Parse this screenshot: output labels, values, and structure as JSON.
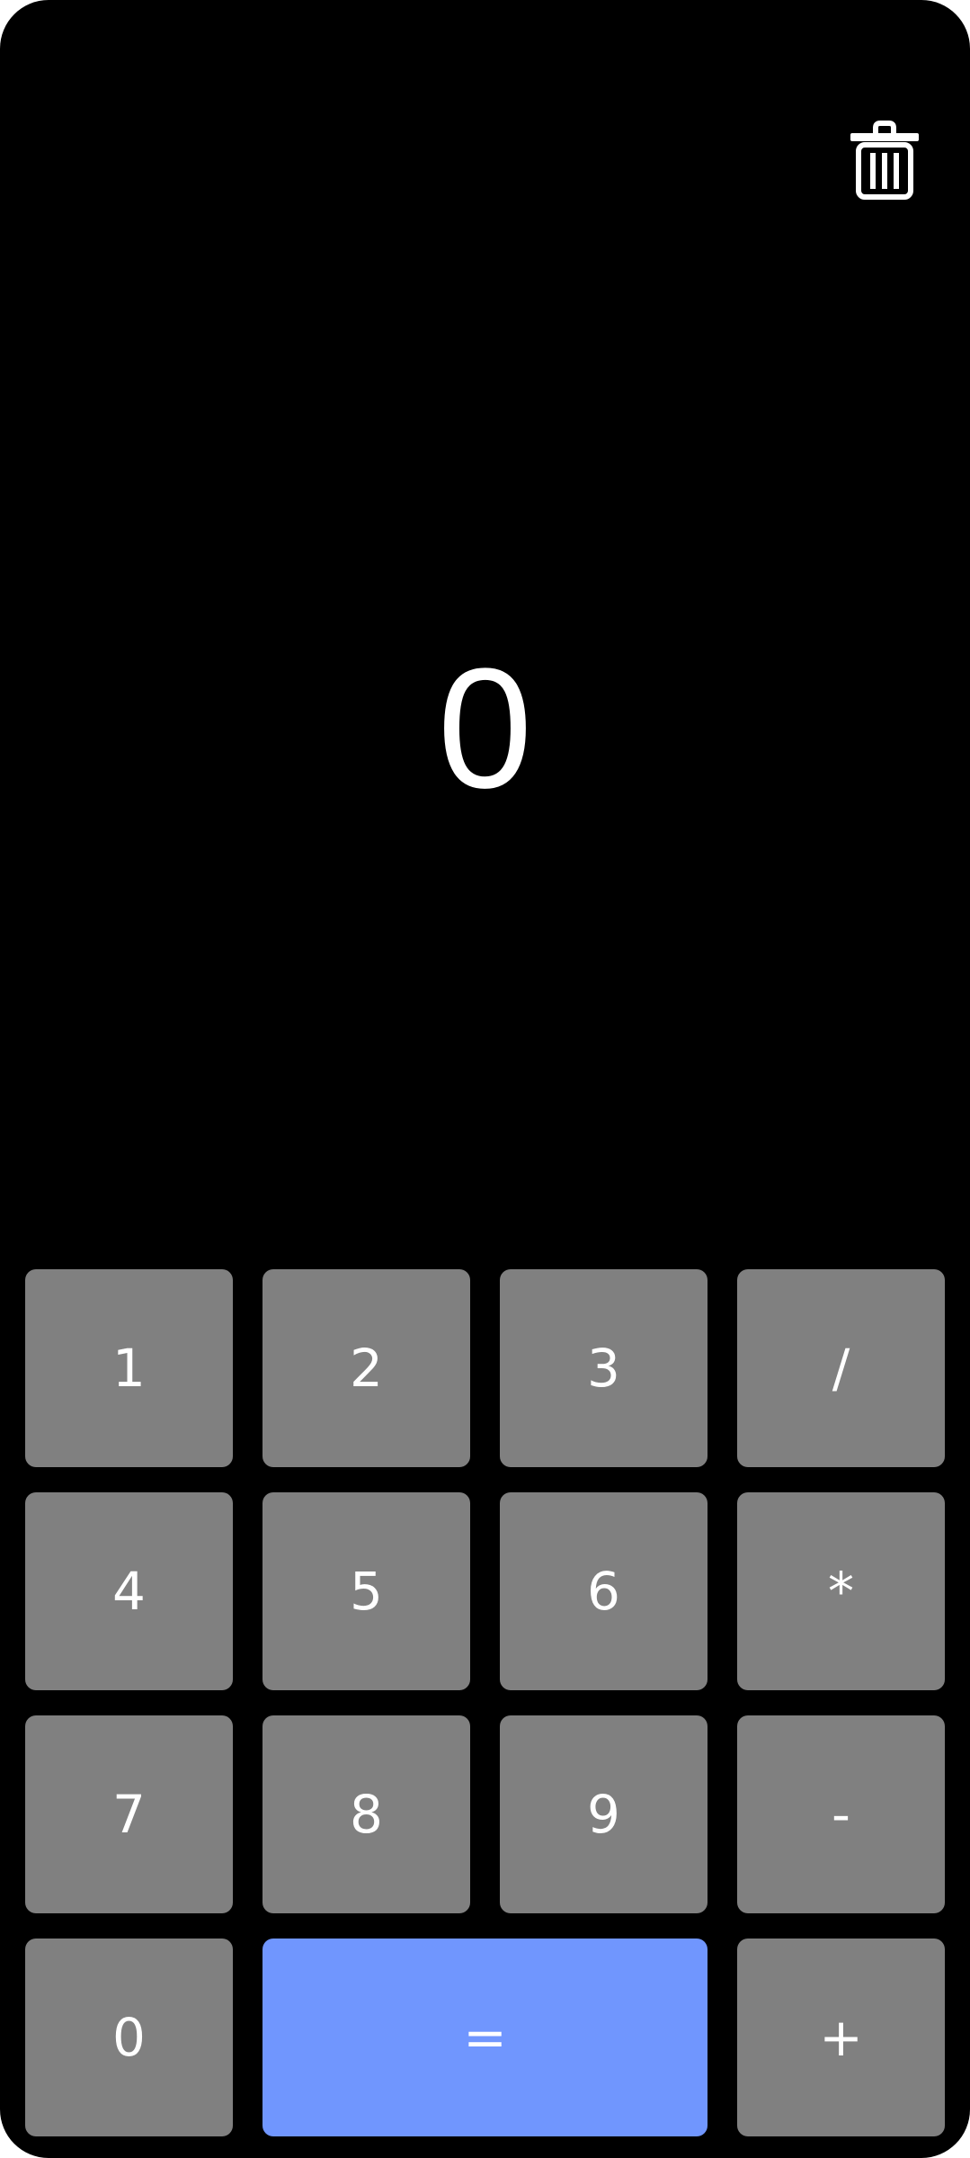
{
  "toolbar": {
    "clear_icon": "trash-icon"
  },
  "display": {
    "value": "0"
  },
  "keypad": {
    "keys": [
      {
        "label": "1"
      },
      {
        "label": "2"
      },
      {
        "label": "3"
      },
      {
        "label": "/"
      },
      {
        "label": "4"
      },
      {
        "label": "5"
      },
      {
        "label": "6"
      },
      {
        "label": "*"
      },
      {
        "label": "7"
      },
      {
        "label": "8"
      },
      {
        "label": "9"
      },
      {
        "label": "-"
      },
      {
        "label": "0"
      },
      {
        "label": "="
      },
      {
        "label": "+"
      }
    ]
  },
  "colors": {
    "background": "#000000",
    "key": "#808080",
    "equals_key": "#7096fe",
    "text": "#ffffff"
  }
}
